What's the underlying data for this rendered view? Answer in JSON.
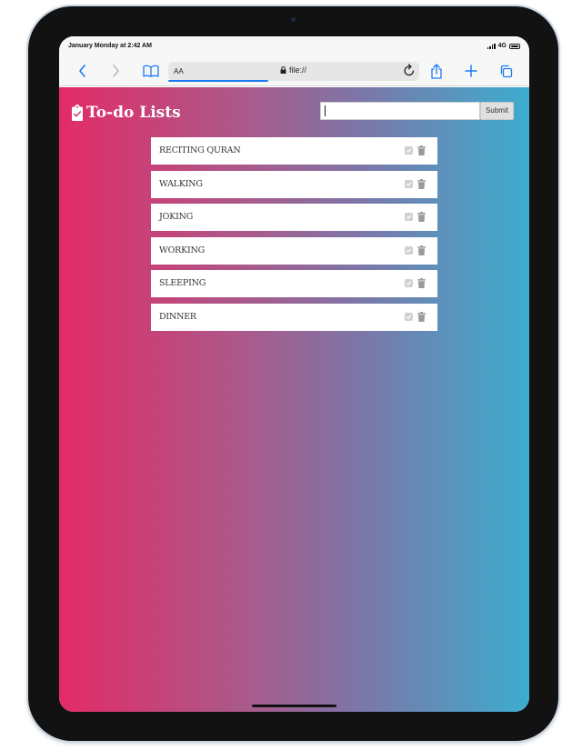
{
  "status": {
    "time": "January Monday at 2:42 AM",
    "network": "4G"
  },
  "browser": {
    "text_size_label": "AA",
    "url": "file://"
  },
  "app": {
    "title": "To-do Lists",
    "input_value": "",
    "submit_label": "Submit",
    "items": [
      {
        "text": "RECITING QURAN"
      },
      {
        "text": "WALKING"
      },
      {
        "text": "JOKING"
      },
      {
        "text": "WORKING"
      },
      {
        "text": "SLEEPING"
      },
      {
        "text": "DINNER"
      }
    ]
  },
  "colors": {
    "gradient_start": "#e32b66",
    "gradient_end": "#3cadcf",
    "browser_accent": "#1a7cf5"
  },
  "icons": {
    "back": "chevron-left-icon",
    "forward": "chevron-right-icon",
    "bookmarks": "book-icon",
    "lock": "lock-icon",
    "reload": "reload-icon",
    "share": "share-icon",
    "new_tab": "plus-icon",
    "tabs": "tabs-icon",
    "logo": "clipboard-check-icon",
    "done": "check-square-icon",
    "delete": "trash-icon"
  }
}
